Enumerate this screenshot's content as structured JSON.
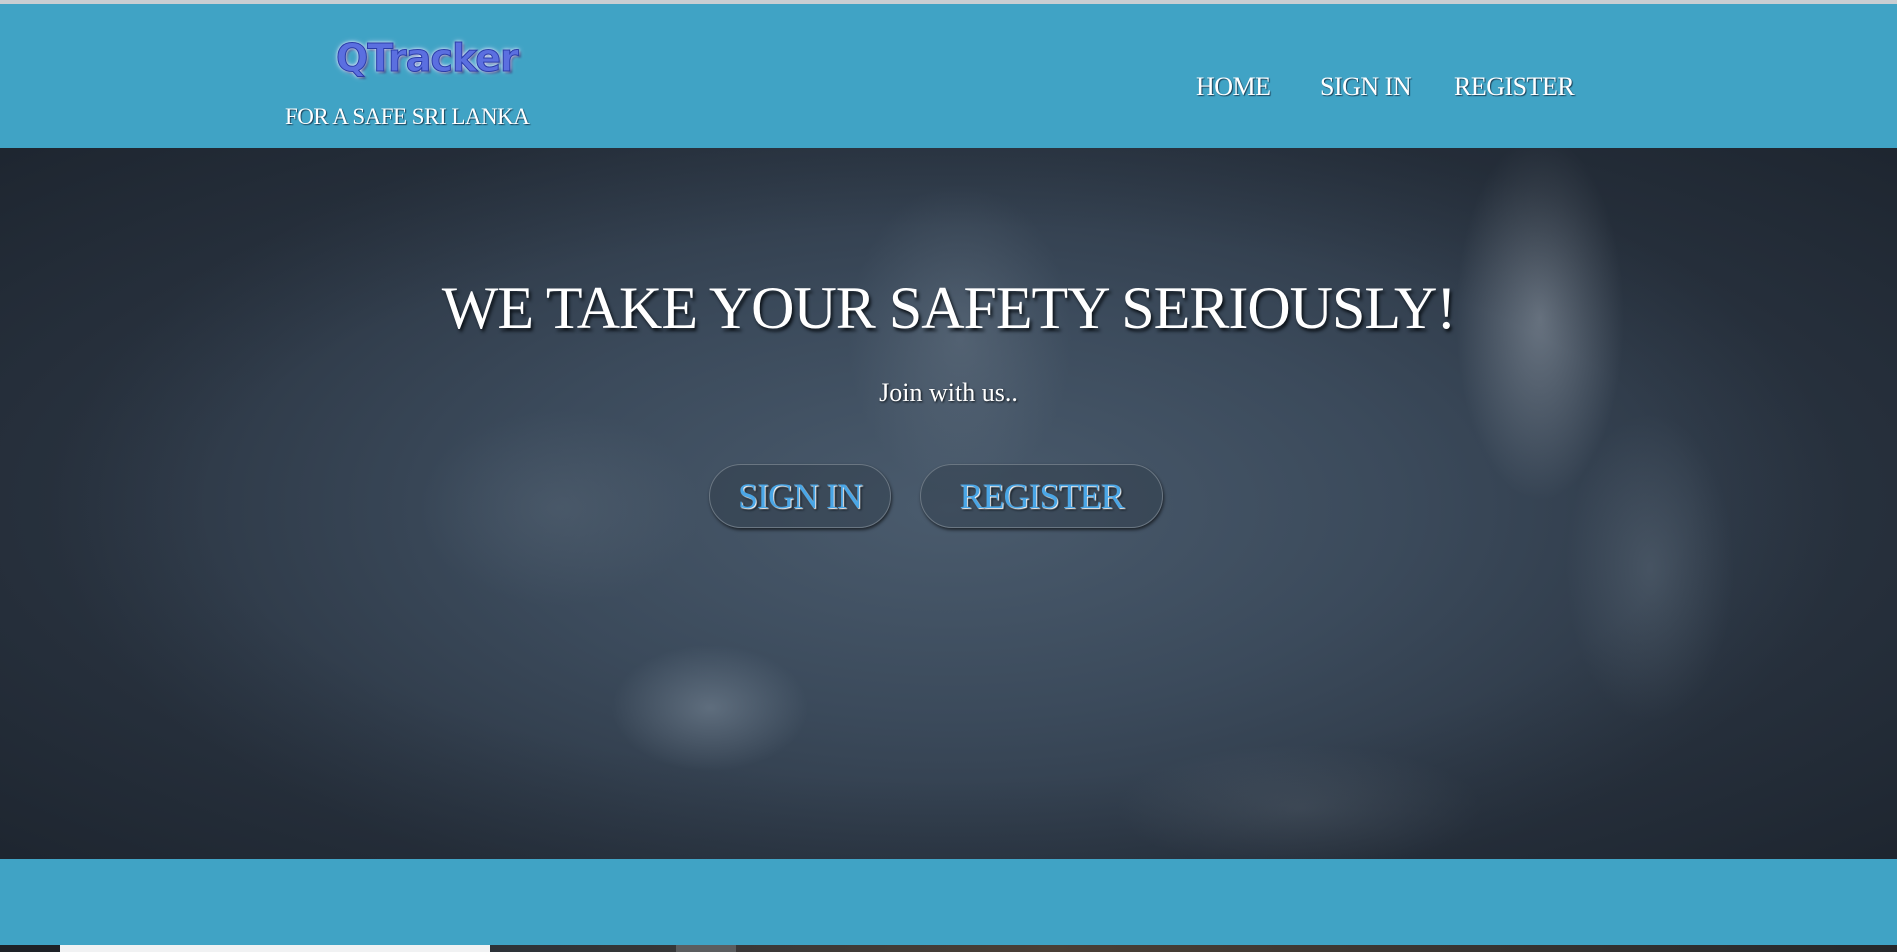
{
  "header": {
    "logo_text": "QTracker",
    "tagline": "FOR A SAFE SRI LANKA",
    "nav": {
      "home": "HOME",
      "sign_in": "SIGN IN",
      "register": "REGISTER"
    }
  },
  "hero": {
    "title": "WE TAKE YOUR SAFETY SERIOUSLY!",
    "subtitle": "Join with us..",
    "buttons": {
      "sign_in": "SIGN IN",
      "register": "REGISTER"
    }
  },
  "colors": {
    "header_bg": "#40a3c5",
    "button_text": "#4aa6e6",
    "logo": "#5b6fe0"
  }
}
